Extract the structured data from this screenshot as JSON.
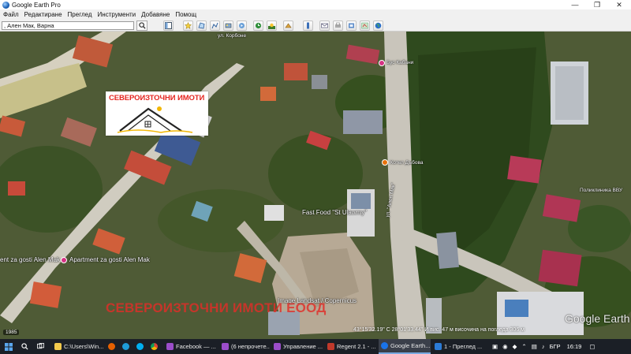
{
  "window": {
    "title": "Google Earth Pro",
    "controls": {
      "minimize": "—",
      "maximize": "❐",
      "close": "✕"
    }
  },
  "menu": [
    "Файл",
    "Редактиране",
    "Преглед",
    "Инструменти",
    "Добавяне",
    "Помощ"
  ],
  "search": {
    "value": ", Ален Мак, Варна"
  },
  "toolbar_icons": [
    "sidebar-toggle-icon",
    "placemark-icon",
    "polygon-icon",
    "path-icon",
    "overlay-icon",
    "tour-icon",
    "history-icon",
    "sunlight-icon",
    "planets-icon",
    "ruler-icon",
    "email-icon",
    "print-icon",
    "save-image-icon",
    "maps-icon"
  ],
  "map": {
    "logo_text": "СЕВЕРОИЗТОЧНИ ИМОТИ",
    "watermark": "СЕВЕРОИЗТОЧНИ ИМОТИ ЕООД",
    "labels": {
      "street_top": "ул. Корбоне",
      "bus_stop": "Бус Кабани",
      "tourist_center": "Хотел Дъбова",
      "fast_food": "Fast Food \"St Ulawmy\"",
      "apartment_left": "ent za gosti Alen Mak",
      "apartment_main": "Apartment za gosti Alen Mak",
      "image_credit": "Image Landsat / Copernicus",
      "polyclinic": "Поликлиника ВВУ",
      "road": "ул. \"Ален Мак\""
    },
    "google_earth": "Google Earth",
    "status": "43°15'32.19\" С  28°01'33.44\" И  вис. 47 м     височина на погледа  306 м",
    "counter": "1985"
  },
  "taskbar": {
    "items": [
      {
        "label": "C:\\Users\\Win...",
        "icon_color": "#f2c94c"
      },
      {
        "label": "Facebook — ...",
        "icon_color": "#9b4dca"
      },
      {
        "label": "(6 непрочете...",
        "icon_color": "#9b4dca"
      },
      {
        "label": "Управление ...",
        "icon_color": "#9b4dca"
      },
      {
        "label": "Regent 2.1 - ...",
        "icon_color": "#c0392b"
      },
      {
        "label": "Google Earth...",
        "icon_color": "#1a73e8"
      },
      {
        "label": "1 - Преглед ...",
        "icon_color": "#2b7bd6"
      }
    ],
    "lang": "БГР",
    "time": "16:19"
  },
  "colors": {
    "accent_red": "#e52620",
    "taskbar": "#1b1f26"
  }
}
